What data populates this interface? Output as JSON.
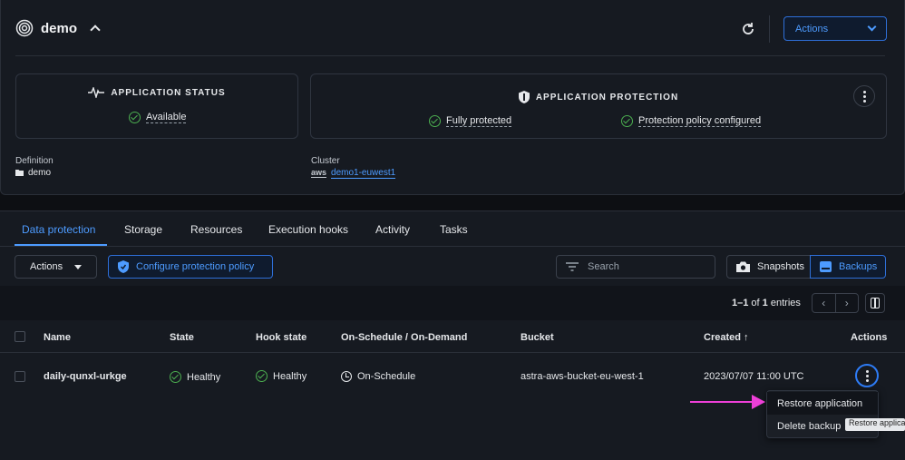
{
  "app": {
    "title": "demo"
  },
  "header": {
    "actions_label": "Actions"
  },
  "status_panel": {
    "title": "APPLICATION STATUS",
    "status": "Available"
  },
  "protection_panel": {
    "title": "APPLICATION PROTECTION",
    "status1": "Fully protected",
    "status2": "Protection policy configured"
  },
  "meta": {
    "definition_label": "Definition",
    "definition_value": "demo",
    "cluster_label": "Cluster",
    "cluster_provider": "aws",
    "cluster_value": "demo1-euwest1"
  },
  "tabs": [
    "Data protection",
    "Storage",
    "Resources",
    "Execution hooks",
    "Activity",
    "Tasks"
  ],
  "toolbar": {
    "actions_label": "Actions",
    "config_label": "Configure protection policy",
    "search_placeholder": "Search",
    "snapshots_label": "Snapshots",
    "backups_label": "Backups",
    "entries_range": "1–1",
    "entries_of": "of",
    "entries_total": "1",
    "entries_suffix": "entries"
  },
  "table": {
    "headers": [
      "Name",
      "State",
      "Hook state",
      "On-Schedule / On-Demand",
      "Bucket",
      "Created",
      "Actions"
    ],
    "sort_indicator": "↑",
    "rows": [
      {
        "name": "daily-qunxl-urkge",
        "state": "Healthy",
        "hook_state": "Healthy",
        "schedule": "On-Schedule",
        "bucket": "astra-aws-bucket-eu-west-1",
        "created": "2023/07/07 11:00 UTC"
      }
    ]
  },
  "row_menu": {
    "items": [
      "Restore application",
      "Delete backup"
    ],
    "tooltip": "Restore application"
  },
  "colors": {
    "accent": "#4d9bff",
    "success": "#4caf50",
    "annotation_arrow": "#ee3fd8"
  }
}
